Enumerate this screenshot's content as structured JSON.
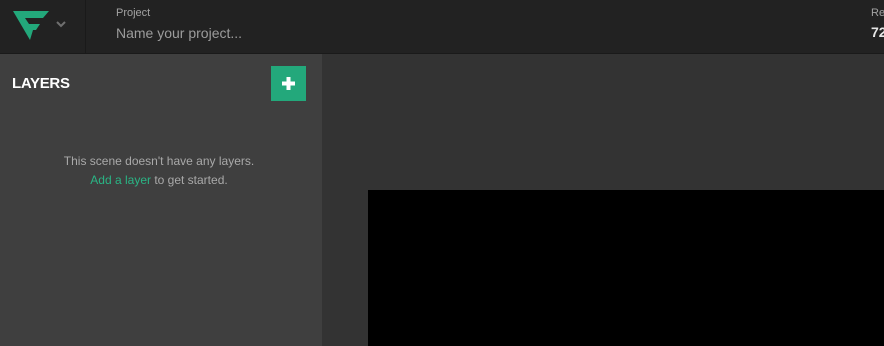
{
  "header": {
    "project_label": "Project",
    "project_placeholder": "Name your project...",
    "project_value": "",
    "resolution_label": "Re",
    "resolution_value": "72"
  },
  "icons": {
    "logo": "app-logo",
    "menu": "chevron-down-icon",
    "add": "plus-icon"
  },
  "layers": {
    "title": "LAYERS",
    "empty_line1": "This scene doesn't have any layers.",
    "add_link": "Add a layer",
    "empty_suffix": " to get started."
  },
  "colors": {
    "accent": "#23a87b",
    "topbar": "#222222",
    "panel": "#3f3f3f",
    "workspace": "#333333",
    "stage": "#000000"
  }
}
